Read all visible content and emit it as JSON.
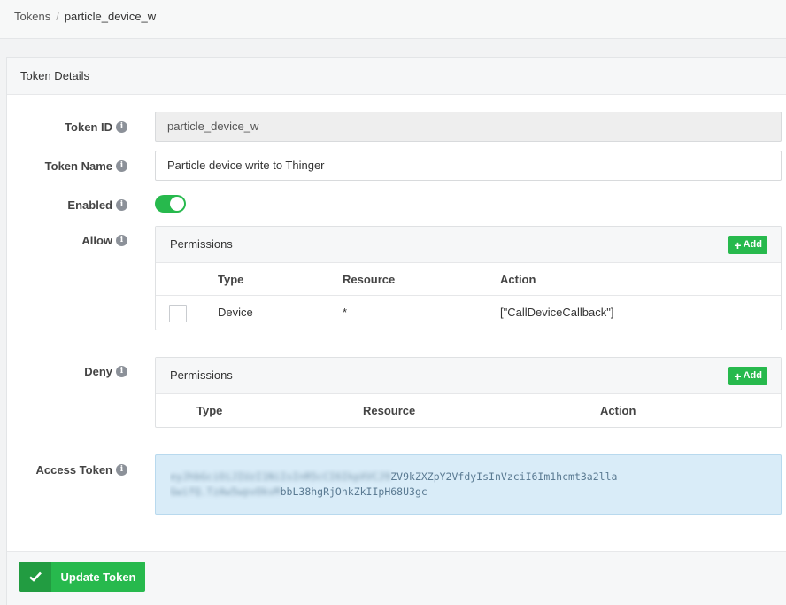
{
  "breadcrumb": {
    "parent": "Tokens",
    "separator": "/",
    "current": "particle_device_w"
  },
  "panel": {
    "title": "Token Details"
  },
  "form": {
    "token_id": {
      "label": "Token ID",
      "value": "particle_device_w"
    },
    "token_name": {
      "label": "Token Name",
      "value": "Particle device write to Thinger"
    },
    "enabled": {
      "label": "Enabled",
      "on": true
    },
    "allow": {
      "label": "Allow"
    },
    "deny": {
      "label": "Deny"
    },
    "access_token": {
      "label": "Access Token",
      "line1_visible_start": "eyJhbGciOiJIUzI1NiIsInR5cCI6IkpXVCJ9",
      "line1_visible_end": "ZV9kZXZpY2VfdyIsInVzciI6Im1hcmt3a2lla",
      "line2_visible_start": "GwifQ.TzAw5wpvOkvM",
      "line2_visible_end": "bbL38hgRjOhkZkIIpH68U3gc"
    }
  },
  "permissions": {
    "title": "Permissions",
    "add_label": "Add",
    "columns": {
      "type": "Type",
      "resource": "Resource",
      "action": "Action"
    },
    "allow_rows": [
      {
        "type": "Device",
        "resource": "*",
        "action": "[\"CallDeviceCallback\"]"
      }
    ]
  },
  "footer": {
    "update_label": "Update Token"
  },
  "colors": {
    "accent": "#27b94d",
    "token_bg": "#d9ecf8"
  },
  "icons": {
    "info": "info-icon",
    "check": "check-icon",
    "plus": "plus-icon"
  }
}
